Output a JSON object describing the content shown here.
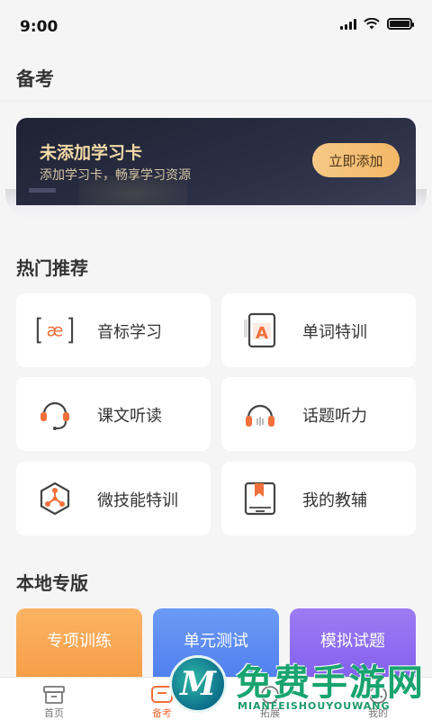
{
  "status_bar": {
    "time": "9:00"
  },
  "header": {
    "title": "备考"
  },
  "study_card": {
    "title": "未添加学习卡",
    "subtitle": "添加学习卡，畅享学习资源",
    "button_label": "立即添加"
  },
  "hot": {
    "title": "热门推荐",
    "items": [
      {
        "label": "音标学习",
        "icon": "phonetic-icon"
      },
      {
        "label": "单词特训",
        "icon": "word-card-icon"
      },
      {
        "label": "课文听读",
        "icon": "headset-mic-icon"
      },
      {
        "label": "话题听力",
        "icon": "headphones-icon"
      },
      {
        "label": "微技能特训",
        "icon": "hexagon-skill-icon"
      },
      {
        "label": "我的教辅",
        "icon": "book-icon"
      }
    ],
    "icon_glyphs": {
      "phonetic": "[æ]",
      "word": "A"
    }
  },
  "local": {
    "title": "本地专版",
    "cards": [
      {
        "label": "专项训练",
        "color": "#f9a94f"
      },
      {
        "label": "单元测试",
        "color": "#5b8bf2"
      },
      {
        "label": "模拟试题",
        "color": "#8f6cf0"
      }
    ]
  },
  "tabbar": {
    "tabs": [
      {
        "label": "首页",
        "active": false
      },
      {
        "label": "备考",
        "active": true
      },
      {
        "label": "拓展",
        "active": false
      },
      {
        "label": "我的",
        "active": false
      }
    ]
  },
  "watermark": {
    "brand": "免费手游网",
    "domain": "MIANFEISHOUYOUWANG",
    "logo_letter": "M"
  },
  "colors": {
    "accent": "#f1703c",
    "card_gold": "#f3d9a6",
    "tab_active": "#f1703c"
  }
}
